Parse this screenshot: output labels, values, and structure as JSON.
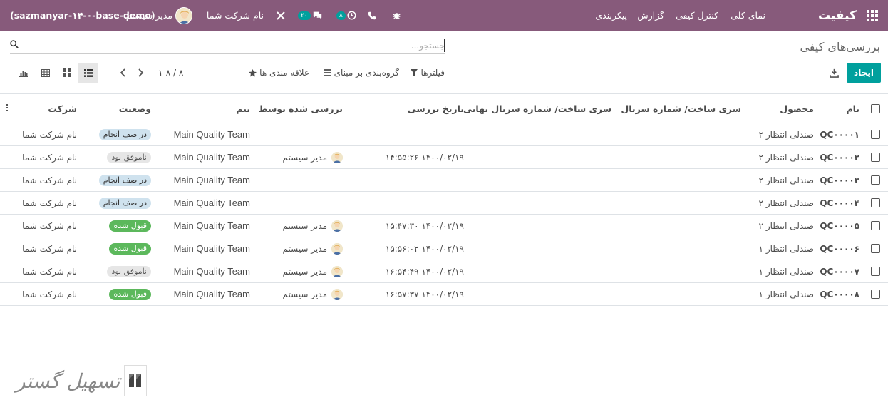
{
  "navbar": {
    "brand": "کیفیت",
    "menu": [
      "نمای کلی",
      "کنترل کیفی",
      "گزارش",
      "پیکربندی"
    ],
    "activity_badge": "۸",
    "discuss_badge": "۲۰",
    "company": "نام شرکت شما",
    "user": "مدیر سیستم",
    "database": "(sazmanyar-۱۴-۰-base-demo)"
  },
  "page": {
    "breadcrumb": "بررسی‌های کیفی",
    "search_placeholder": "جستجو..."
  },
  "toolbar": {
    "create_label": "ایجاد",
    "filters_label": "فیلترها",
    "groupby_label": "گروه‌بندی بر مبنای",
    "favorites_label": "علاقه مندی ها",
    "pager_value": "۱-۸ / ۸"
  },
  "table": {
    "headers": {
      "name": "نام",
      "product": "محصول",
      "lot": "سری ساخت/ شماره سریال",
      "lot_final": "سری ساخت/ شماره سریال نهایی",
      "date": "تاریخ بررسی",
      "checked_by": "بررسی شده توسط",
      "team": "تیم",
      "state": "وضعیت",
      "company": "شرکت"
    },
    "rows": [
      {
        "name": "QC۰۰۰۰۱",
        "product": "صندلی انتظار ۲",
        "date": "",
        "checked_by": "",
        "team": "Main Quality Team",
        "state": "در صف انجام",
        "state_kind": "queue",
        "company": "نام شرکت شما"
      },
      {
        "name": "QC۰۰۰۰۲",
        "product": "صندلی انتظار ۲",
        "date": "۱۴۰۰/۰۲/۱۹ ۱۴:۵۵:۲۶",
        "checked_by": "مدیر سیستم",
        "team": "Main Quality Team",
        "state": "ناموفق بود",
        "state_kind": "fail",
        "company": "نام شرکت شما"
      },
      {
        "name": "QC۰۰۰۰۳",
        "product": "صندلی انتظار ۲",
        "date": "",
        "checked_by": "",
        "team": "Main Quality Team",
        "state": "در صف انجام",
        "state_kind": "queue",
        "company": "نام شرکت شما"
      },
      {
        "name": "QC۰۰۰۰۴",
        "product": "صندلی انتظار ۲",
        "date": "",
        "checked_by": "",
        "team": "Main Quality Team",
        "state": "در صف انجام",
        "state_kind": "queue",
        "company": "نام شرکت شما"
      },
      {
        "name": "QC۰۰۰۰۵",
        "product": "صندلی انتظار ۲",
        "date": "۱۴۰۰/۰۲/۱۹ ۱۵:۴۷:۳۰",
        "checked_by": "مدیر سیستم",
        "team": "Main Quality Team",
        "state": "قبول شده",
        "state_kind": "pass",
        "company": "نام شرکت شما"
      },
      {
        "name": "QC۰۰۰۰۶",
        "product": "صندلی انتظار ۱",
        "date": "۱۴۰۰/۰۲/۱۹ ۱۵:۵۶:۰۲",
        "checked_by": "مدیر سیستم",
        "team": "Main Quality Team",
        "state": "قبول شده",
        "state_kind": "pass",
        "company": "نام شرکت شما"
      },
      {
        "name": "QC۰۰۰۰۷",
        "product": "صندلی انتظار ۱",
        "date": "۱۴۰۰/۰۲/۱۹ ۱۶:۵۴:۴۹",
        "checked_by": "مدیر سیستم",
        "team": "Main Quality Team",
        "state": "ناموفق بود",
        "state_kind": "fail",
        "company": "نام شرکت شما"
      },
      {
        "name": "QC۰۰۰۰۸",
        "product": "صندلی انتظار ۱",
        "date": "۱۴۰۰/۰۲/۱۹ ۱۶:۵۷:۳۷",
        "checked_by": "مدیر سیستم",
        "team": "Main Quality Team",
        "state": "قبول شده",
        "state_kind": "pass",
        "company": "نام شرکت شما"
      }
    ]
  },
  "watermark": {
    "text": "تسهیل گستر"
  },
  "colors": {
    "brand": "#875a7b",
    "primary": "#00a09d",
    "pass": "#5cb85c",
    "queue": "#cfe2ee",
    "fail": "#e6e6e6"
  }
}
